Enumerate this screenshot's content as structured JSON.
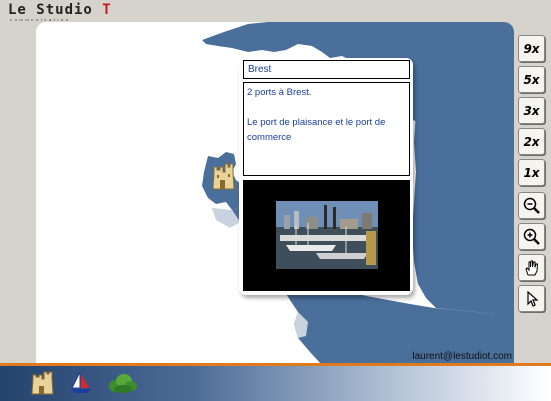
{
  "brand": {
    "title_main": "Le Studio ",
    "title_accent": "T",
    "subtitle": "communication"
  },
  "map": {
    "land_color": "#4a6f9a",
    "water_color": "#ffffff",
    "marker_icon": "castle-icon",
    "credit": "laurent@lestudiot.com"
  },
  "popup": {
    "title": "Brest",
    "lines": [
      "2 ports à Brest.",
      "",
      "Le port de plaisance et le port de commerce"
    ],
    "image_icon": "harbor-photo"
  },
  "toolbar": {
    "zoom_levels": [
      "9x",
      "5x",
      "3x",
      "2x",
      "1x"
    ],
    "zoom_out_icon": "zoom-out-icon",
    "zoom_in_icon": "zoom-in-icon",
    "pan_icon": "hand-icon",
    "select_icon": "pointer-icon"
  },
  "bottom_bar": {
    "accent_color": "#e07a1e",
    "icons": [
      "castle-icon",
      "sailboat-icon",
      "shrub-icon"
    ]
  }
}
